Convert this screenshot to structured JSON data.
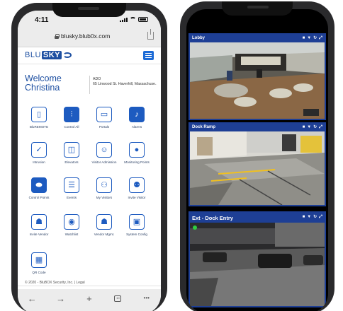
{
  "left_phone": {
    "status_bar": {
      "time": "4:11"
    },
    "browser": {
      "url": "blusky.blub0x.com"
    },
    "header": {
      "logo_text_a": "BLU",
      "logo_text_b": "SKY"
    },
    "welcome": {
      "line1": "Welcome",
      "line2": "Christina"
    },
    "site": {
      "name": "ADO",
      "address": "65 Linwood St. Haverhill, Massachuse..."
    },
    "tiles": [
      {
        "label": "BluREMOTE",
        "icon": "remote-icon"
      },
      {
        "label": "Control All",
        "icon": "sliders-icon"
      },
      {
        "label": "Portals",
        "icon": "door-icon"
      },
      {
        "label": "Alarms",
        "icon": "bell-icon"
      },
      {
        "label": "Intrusion",
        "icon": "shield-icon"
      },
      {
        "label": "Elevators",
        "icon": "elevator-icon"
      },
      {
        "label": "Visitor Admission",
        "icon": "visitor-icon"
      },
      {
        "label": "Monitoring Points",
        "icon": "monitor-point-icon"
      },
      {
        "label": "Control Points",
        "icon": "toggle-icon"
      },
      {
        "label": "Events",
        "icon": "list-icon"
      },
      {
        "label": "My Visitors",
        "icon": "people-icon"
      },
      {
        "label": "Invite Visitor",
        "icon": "invite-icon"
      },
      {
        "label": "Invite Vendor",
        "icon": "vendor-icon"
      },
      {
        "label": "Watchlist",
        "icon": "eye-icon"
      },
      {
        "label": "Vendor Mgmt.",
        "icon": "vendor-mgmt-icon"
      },
      {
        "label": "System Config",
        "icon": "config-icon"
      },
      {
        "label": "QR Code",
        "icon": "qr-icon"
      }
    ],
    "footer": "© 2020 - BluBOX Security, Inc. | Legal",
    "toolbar": {
      "back": "←",
      "forward": "→",
      "new": "+",
      "tabs": "10",
      "more": "•••"
    }
  },
  "right_phone": {
    "cameras": [
      {
        "name": "Lobby"
      },
      {
        "name": "Dock Ramp"
      },
      {
        "name": "Ext - Dock Entry"
      }
    ],
    "colors": {
      "panel_header": "#1e3f95",
      "status_dot": "#2ecc40"
    }
  },
  "colors": {
    "brand": "#1d4fa1",
    "tile_accent": "#1d5bc0"
  }
}
